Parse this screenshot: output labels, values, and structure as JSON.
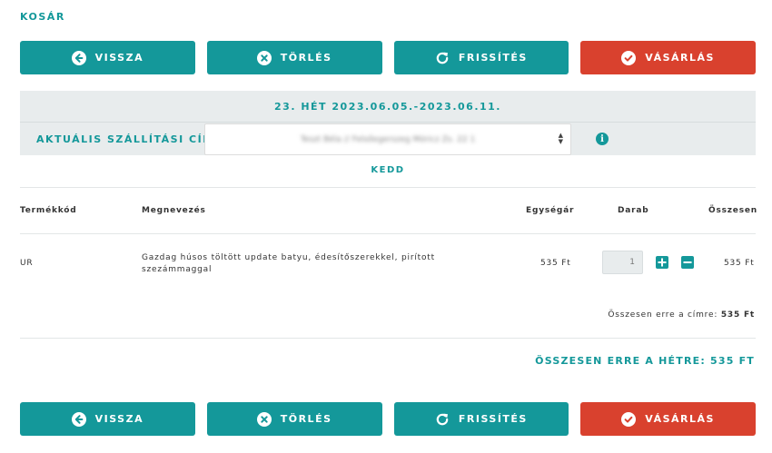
{
  "page": {
    "title": "KOSÁR"
  },
  "actions": {
    "back_label": "VISSZA",
    "delete_label": "TÖRLÉS",
    "refresh_label": "FRISSÍTÉS",
    "buy_label": "VÁSÁRLÁS"
  },
  "week": {
    "label": "23. HÉT 2023.06.05.-2023.06.11."
  },
  "address": {
    "label": "AKTUÁLIS SZÁLLÍTÁSI CÍM:",
    "selected": "Teszt Béla // Felsőegerszeg Móricz Zs. 22 1",
    "info_icon": "info-circle-icon"
  },
  "day": {
    "label": "KEDD"
  },
  "table": {
    "headers": {
      "code": "Termékkód",
      "name": "Megnevezés",
      "unit_price": "Egységár",
      "qty": "Darab",
      "total": "Összesen"
    },
    "rows": [
      {
        "code": "UR",
        "name_line1": "Gazdag húsos töltött update batyu, édesítőszerekkel, pirított",
        "name_line2": "szezámmaggal",
        "unit_price": "535 Ft",
        "qty": "1",
        "total": "535 Ft"
      }
    ]
  },
  "subtotal": {
    "label": "Összesen erre a címre:",
    "value": "535 Ft"
  },
  "week_total": {
    "label": "ÖSSZESEN ERRE A HÉTRE: 535 FT"
  },
  "colors": {
    "accent": "#14989a",
    "danger": "#d9412e",
    "panel": "#e8eced"
  },
  "icons": {
    "back": "arrow-left-circle-icon",
    "delete": "x-circle-icon",
    "refresh": "refresh-icon",
    "buy": "check-circle-icon",
    "plus": "plus-icon",
    "minus": "minus-icon"
  }
}
